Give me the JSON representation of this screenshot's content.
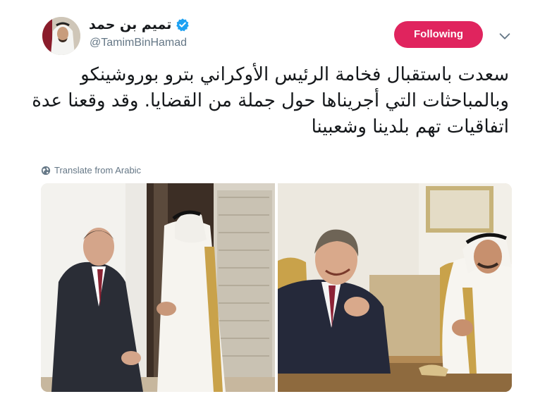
{
  "header": {
    "display_name": "تميم بن حمد",
    "handle": "@TamimBinHamad",
    "verified_icon": "verified-badge-icon",
    "follow_label": "Following",
    "menu_icon": "chevron-down-icon"
  },
  "tweet": {
    "text": "سعدت باستقبال فخامة الرئيس الأوكراني بترو بوروشينكو وبالمباحثات التي أجريناها حول جملة من القضايا. وقد وقعنا عدة اتفاقيات تهم بلدينا وشعبينا",
    "translate_label": "Translate from Arabic",
    "translate_icon": "globe-icon"
  },
  "media": {
    "photos": [
      {
        "name": "photo-standing-meeting"
      },
      {
        "name": "photo-seated-meeting"
      }
    ]
  },
  "colors": {
    "follow_button": "#e0245e",
    "verified": "#1da1f2",
    "secondary_text": "#657786",
    "primary_text": "#14171a"
  }
}
